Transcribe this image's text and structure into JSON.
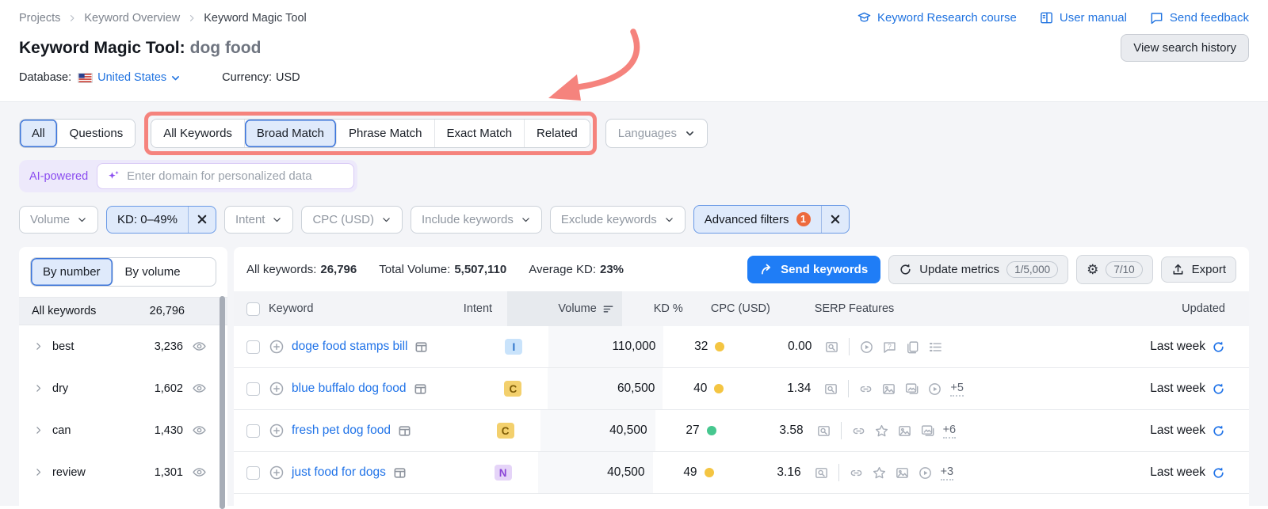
{
  "header": {
    "breadcrumb": [
      "Projects",
      "Keyword Overview",
      "Keyword Magic Tool"
    ],
    "links": [
      {
        "label": "Keyword Research course",
        "icon": "grad-cap"
      },
      {
        "label": "User manual",
        "icon": "book"
      },
      {
        "label": "Send feedback",
        "icon": "chat"
      }
    ],
    "title": "Keyword Magic Tool:",
    "query": "dog food",
    "view_search_history": "View search history",
    "database_label": "Database:",
    "database_value": "United States",
    "currency_label": "Currency:",
    "currency_value": "USD"
  },
  "tabs": {
    "group1": [
      {
        "label": "All",
        "active": true
      },
      {
        "label": "Questions",
        "active": false
      }
    ],
    "group2": [
      {
        "label": "All Keywords",
        "active": false
      },
      {
        "label": "Broad Match",
        "active": true
      },
      {
        "label": "Phrase Match",
        "active": false
      },
      {
        "label": "Exact Match",
        "active": false
      },
      {
        "label": "Related",
        "active": false
      }
    ],
    "languages_label": "Languages"
  },
  "ai_bar": {
    "badge": "AI-powered",
    "placeholder": "Enter domain for personalized data"
  },
  "filters": [
    {
      "label": "Volume",
      "chevron": true,
      "active": false,
      "close": false,
      "badge": ""
    },
    {
      "label": "KD: 0–49%",
      "chevron": false,
      "active": true,
      "close": true,
      "badge": ""
    },
    {
      "label": "Intent",
      "chevron": true,
      "active": false,
      "close": false,
      "badge": ""
    },
    {
      "label": "CPC (USD)",
      "chevron": true,
      "active": false,
      "close": false,
      "badge": ""
    },
    {
      "label": "Include keywords",
      "chevron": true,
      "active": false,
      "close": false,
      "badge": ""
    },
    {
      "label": "Exclude keywords",
      "chevron": true,
      "active": false,
      "close": false,
      "badge": ""
    },
    {
      "label": "Advanced filters",
      "chevron": false,
      "active": true,
      "close": true,
      "badge": "1"
    }
  ],
  "sidebar": {
    "tabs": [
      {
        "label": "By number",
        "active": true
      },
      {
        "label": "By volume",
        "active": false
      }
    ],
    "all_keywords": {
      "label": "All keywords",
      "count": "26,796"
    },
    "groups": [
      {
        "label": "best",
        "count": "3,236"
      },
      {
        "label": "dry",
        "count": "1,602"
      },
      {
        "label": "can",
        "count": "1,430"
      },
      {
        "label": "review",
        "count": "1,301"
      }
    ]
  },
  "main": {
    "stats": [
      {
        "label": "All keywords:",
        "value": "26,796"
      },
      {
        "label": "Total Volume:",
        "value": "5,507,110"
      },
      {
        "label": "Average KD:",
        "value": "23%"
      }
    ],
    "actions": {
      "send": "Send keywords",
      "update": "Update metrics",
      "update_quota": "1/5,000",
      "gear_quota": "7/10",
      "export": "Export"
    },
    "table": {
      "columns": [
        "Keyword",
        "Intent",
        "Volume",
        "KD %",
        "CPC (USD)",
        "SERP Features",
        "Updated"
      ],
      "rows": [
        {
          "keyword": "doge food stamps bill",
          "intent": "I",
          "volume": "110,000",
          "kd": "32",
          "kd_dot": "yellow",
          "cpc": "0.00",
          "serp_icons": [
            "video",
            "question",
            "copy",
            "list"
          ],
          "serp_more": "",
          "updated": "Last week"
        },
        {
          "keyword": "blue buffalo dog food",
          "intent": "C",
          "volume": "60,500",
          "kd": "40",
          "kd_dot": "yellow",
          "cpc": "1.34",
          "serp_icons": [
            "link",
            "image",
            "image-stack",
            "video"
          ],
          "serp_more": "+5",
          "updated": "Last week"
        },
        {
          "keyword": "fresh pet dog food",
          "intent": "C",
          "volume": "40,500",
          "kd": "27",
          "kd_dot": "green",
          "cpc": "3.58",
          "serp_icons": [
            "link",
            "star",
            "image",
            "image-stack"
          ],
          "serp_more": "+6",
          "updated": "Last week"
        },
        {
          "keyword": "just food for dogs",
          "intent": "N",
          "volume": "40,500",
          "kd": "49",
          "kd_dot": "yellow",
          "cpc": "3.16",
          "serp_icons": [
            "link",
            "star",
            "image",
            "video"
          ],
          "serp_more": "+3",
          "updated": "Last week"
        }
      ]
    }
  },
  "colors": {
    "accent_blue": "#2073e0",
    "send_button": "#1f7df6",
    "selected_bg": "#dfeafb",
    "selected_border": "#3b74d9",
    "annotation_red": "#f5837d",
    "ai_purple": "#8b4df0",
    "orange_badge": "#ed6a3d",
    "kd_dots": {
      "yellow": "#f4c542",
      "green": "#46c78f"
    },
    "intent": {
      "I": {
        "bg": "#c9e3fb",
        "text": "#2a72c9"
      },
      "C": {
        "bg": "#f3d06d",
        "text": "#7d5b05"
      },
      "N": {
        "bg": "#e5d4f8",
        "text": "#8b46d7"
      }
    }
  }
}
